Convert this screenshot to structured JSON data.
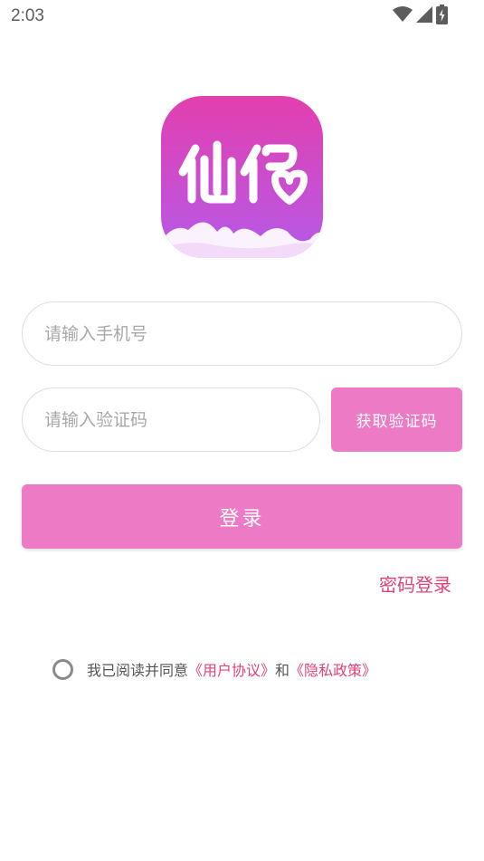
{
  "status_bar": {
    "time": "2:03",
    "icons": [
      "wifi-icon",
      "signal-icon",
      "battery-charging-icon"
    ]
  },
  "logo": {
    "text": "仙侣",
    "colors": {
      "gradient_top": "#e03fb0",
      "gradient_bottom": "#b45ae8",
      "glyph": "#ffffff"
    }
  },
  "phone_input": {
    "placeholder": "请输入手机号",
    "value": ""
  },
  "code_input": {
    "placeholder": "请输入验证码",
    "value": ""
  },
  "get_code_button": {
    "label": "获取验证码"
  },
  "login_button": {
    "label": "登录"
  },
  "password_login_link": {
    "label": "密码登录"
  },
  "agreement": {
    "checked": false,
    "prefix": "我已阅读并同意",
    "user_agreement": "《用户协议》",
    "conjunction": "和",
    "privacy_policy": "《隐私政策》"
  },
  "colors": {
    "accent": "#ec7ac4",
    "link": "#e4407a",
    "input_border": "#dedede",
    "placeholder": "#a8a8a8"
  }
}
